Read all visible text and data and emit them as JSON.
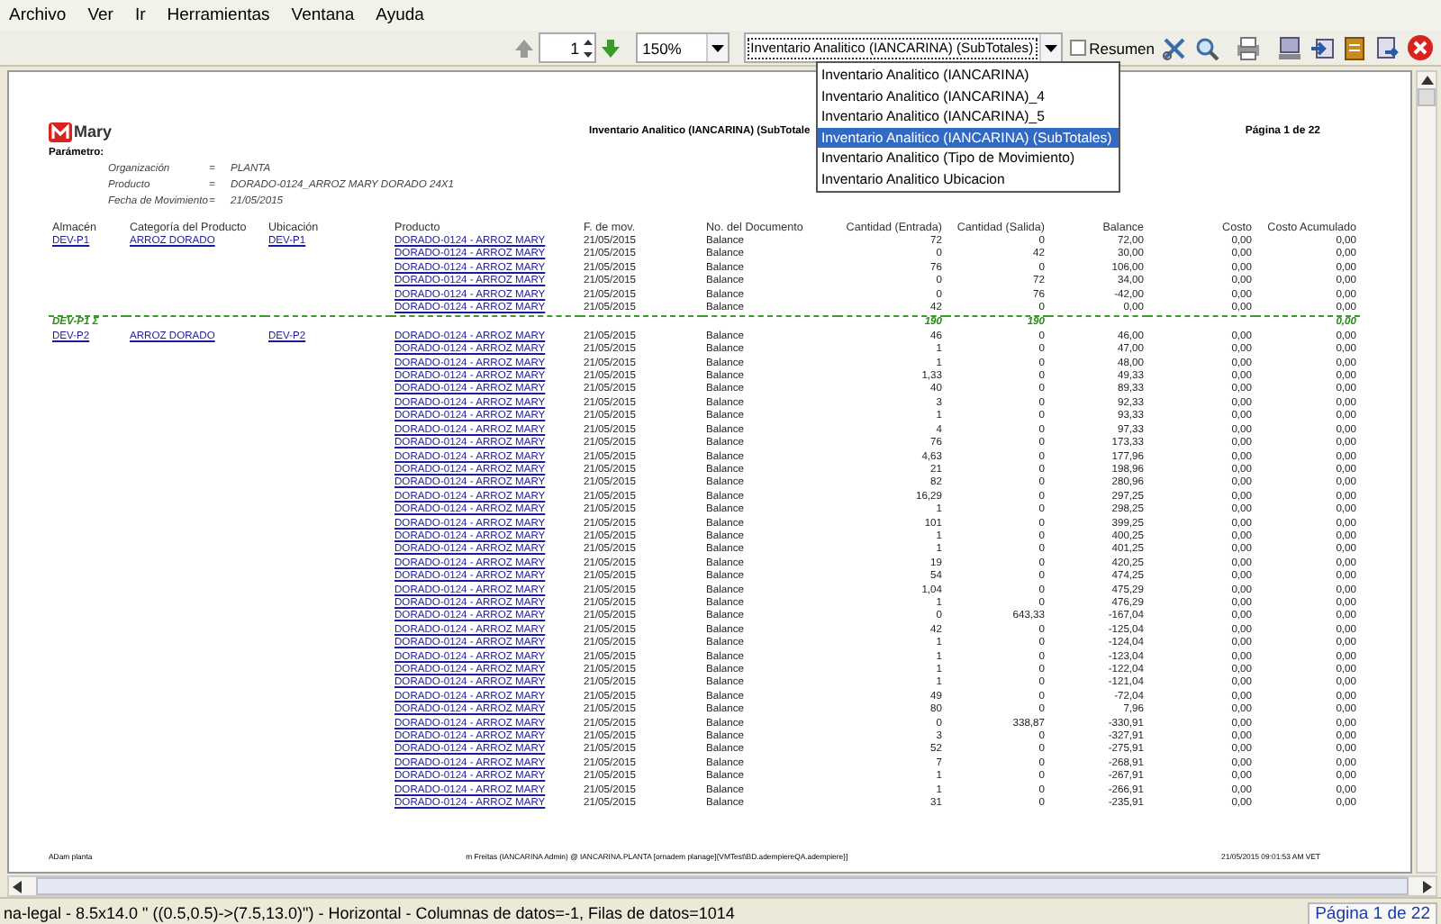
{
  "menu": [
    "Archivo",
    "Ver",
    "Ir",
    "Herramientas",
    "Ventana",
    "Ayuda"
  ],
  "toolbar": {
    "page": "1",
    "zoom": "150%",
    "report": "Inventario Analitico (IANCARINA) (SubTotales)",
    "summary": {
      "label": "Resumen",
      "checked": false
    }
  },
  "report_menu": [
    {
      "label": "Inventario Analitico (IANCARINA)",
      "selected": false
    },
    {
      "label": "Inventario Analitico (IANCARINA)_4",
      "selected": false
    },
    {
      "label": "Inventario Analitico (IANCARINA)_5",
      "selected": false
    },
    {
      "label": "Inventario Analitico (IANCARINA) (SubTotales)",
      "selected": true
    },
    {
      "label": "Inventario Analitico (Tipo de Movimiento)",
      "selected": false
    },
    {
      "label": "Inventario Analitico Ubicacion",
      "selected": false
    }
  ],
  "report": {
    "logo": "Mary",
    "title": "Inventario Analitico (IANCARINA) (SubTotale",
    "page": "Página 1 de 22",
    "parameters_label": "Parámetro:",
    "parameters": [
      {
        "name": "Organización",
        "sign": "=",
        "value": "PLANTA"
      },
      {
        "name": "Producto",
        "sign": "=",
        "value": "DORADO-0124_ARROZ MARY DORADO 24X1"
      },
      {
        "name": "Fecha de Movimiento",
        "sign": "=",
        "value": "21/05/2015"
      }
    ],
    "columns": [
      "Almacén",
      "Categoría del Producto",
      "Ubicación",
      "Producto",
      "F. de mov.",
      "No. del Documento",
      "Cantidad (Entrada)",
      "Cantidad (Salida)",
      "Balance",
      "Costo",
      "Costo Acumulado"
    ],
    "groups": [
      {
        "warehouse": "DEV-P1",
        "category": "ARROZ DORADO",
        "location": "DEV-P1",
        "rows": [
          {
            "product": "DORADO-0124 - ARROZ MARY",
            "date": "21/05/2015",
            "document": "Balance",
            "qty_in": "72",
            "qty_out": "0",
            "balance": "72,00",
            "cost": "0,00",
            "cumulative_cost": "0,00"
          },
          {
            "product": "DORADO-0124 - ARROZ MARY",
            "date": "21/05/2015",
            "document": "Balance",
            "qty_in": "0",
            "qty_out": "42",
            "balance": "30,00",
            "cost": "0,00",
            "cumulative_cost": "0,00"
          },
          {
            "product": "DORADO-0124 - ARROZ MARY",
            "date": "21/05/2015",
            "document": "Balance",
            "qty_in": "76",
            "qty_out": "0",
            "balance": "106,00",
            "cost": "0,00",
            "cumulative_cost": "0,00"
          },
          {
            "product": "DORADO-0124 - ARROZ MARY",
            "date": "21/05/2015",
            "document": "Balance",
            "qty_in": "0",
            "qty_out": "72",
            "balance": "34,00",
            "cost": "0,00",
            "cumulative_cost": "0,00"
          },
          {
            "product": "DORADO-0124 - ARROZ MARY",
            "date": "21/05/2015",
            "document": "Balance",
            "qty_in": "0",
            "qty_out": "76",
            "balance": "-42,00",
            "cost": "0,00",
            "cumulative_cost": "0,00"
          },
          {
            "product": "DORADO-0124 - ARROZ MARY",
            "date": "21/05/2015",
            "document": "Balance",
            "qty_in": "42",
            "qty_out": "0",
            "balance": "0,00",
            "cost": "0,00",
            "cumulative_cost": "0,00"
          }
        ],
        "subtotal": {
          "label": "DEV-P1 Σ",
          "qty_in": "190",
          "qty_out": "190",
          "cumulative_cost": "0,00"
        }
      },
      {
        "warehouse": "DEV-P2",
        "category": "ARROZ DORADO",
        "location": "DEV-P2",
        "rows": [
          {
            "product": "DORADO-0124 - ARROZ MARY",
            "date": "21/05/2015",
            "document": "Balance",
            "qty_in": "46",
            "qty_out": "0",
            "balance": "46,00",
            "cost": "0,00",
            "cumulative_cost": "0,00"
          },
          {
            "product": "DORADO-0124 - ARROZ MARY",
            "date": "21/05/2015",
            "document": "Balance",
            "qty_in": "1",
            "qty_out": "0",
            "balance": "47,00",
            "cost": "0,00",
            "cumulative_cost": "0,00"
          },
          {
            "product": "DORADO-0124 - ARROZ MARY",
            "date": "21/05/2015",
            "document": "Balance",
            "qty_in": "1",
            "qty_out": "0",
            "balance": "48,00",
            "cost": "0,00",
            "cumulative_cost": "0,00"
          },
          {
            "product": "DORADO-0124 - ARROZ MARY",
            "date": "21/05/2015",
            "document": "Balance",
            "qty_in": "1,33",
            "qty_out": "0",
            "balance": "49,33",
            "cost": "0,00",
            "cumulative_cost": "0,00"
          },
          {
            "product": "DORADO-0124 - ARROZ MARY",
            "date": "21/05/2015",
            "document": "Balance",
            "qty_in": "40",
            "qty_out": "0",
            "balance": "89,33",
            "cost": "0,00",
            "cumulative_cost": "0,00"
          },
          {
            "product": "DORADO-0124 - ARROZ MARY",
            "date": "21/05/2015",
            "document": "Balance",
            "qty_in": "3",
            "qty_out": "0",
            "balance": "92,33",
            "cost": "0,00",
            "cumulative_cost": "0,00"
          },
          {
            "product": "DORADO-0124 - ARROZ MARY",
            "date": "21/05/2015",
            "document": "Balance",
            "qty_in": "1",
            "qty_out": "0",
            "balance": "93,33",
            "cost": "0,00",
            "cumulative_cost": "0,00"
          },
          {
            "product": "DORADO-0124 - ARROZ MARY",
            "date": "21/05/2015",
            "document": "Balance",
            "qty_in": "4",
            "qty_out": "0",
            "balance": "97,33",
            "cost": "0,00",
            "cumulative_cost": "0,00"
          },
          {
            "product": "DORADO-0124 - ARROZ MARY",
            "date": "21/05/2015",
            "document": "Balance",
            "qty_in": "76",
            "qty_out": "0",
            "balance": "173,33",
            "cost": "0,00",
            "cumulative_cost": "0,00"
          },
          {
            "product": "DORADO-0124 - ARROZ MARY",
            "date": "21/05/2015",
            "document": "Balance",
            "qty_in": "4,63",
            "qty_out": "0",
            "balance": "177,96",
            "cost": "0,00",
            "cumulative_cost": "0,00"
          },
          {
            "product": "DORADO-0124 - ARROZ MARY",
            "date": "21/05/2015",
            "document": "Balance",
            "qty_in": "21",
            "qty_out": "0",
            "balance": "198,96",
            "cost": "0,00",
            "cumulative_cost": "0,00"
          },
          {
            "product": "DORADO-0124 - ARROZ MARY",
            "date": "21/05/2015",
            "document": "Balance",
            "qty_in": "82",
            "qty_out": "0",
            "balance": "280,96",
            "cost": "0,00",
            "cumulative_cost": "0,00"
          },
          {
            "product": "DORADO-0124 - ARROZ MARY",
            "date": "21/05/2015",
            "document": "Balance",
            "qty_in": "16,29",
            "qty_out": "0",
            "balance": "297,25",
            "cost": "0,00",
            "cumulative_cost": "0,00"
          },
          {
            "product": "DORADO-0124 - ARROZ MARY",
            "date": "21/05/2015",
            "document": "Balance",
            "qty_in": "1",
            "qty_out": "0",
            "balance": "298,25",
            "cost": "0,00",
            "cumulative_cost": "0,00"
          },
          {
            "product": "DORADO-0124 - ARROZ MARY",
            "date": "21/05/2015",
            "document": "Balance",
            "qty_in": "101",
            "qty_out": "0",
            "balance": "399,25",
            "cost": "0,00",
            "cumulative_cost": "0,00"
          },
          {
            "product": "DORADO-0124 - ARROZ MARY",
            "date": "21/05/2015",
            "document": "Balance",
            "qty_in": "1",
            "qty_out": "0",
            "balance": "400,25",
            "cost": "0,00",
            "cumulative_cost": "0,00"
          },
          {
            "product": "DORADO-0124 - ARROZ MARY",
            "date": "21/05/2015",
            "document": "Balance",
            "qty_in": "1",
            "qty_out": "0",
            "balance": "401,25",
            "cost": "0,00",
            "cumulative_cost": "0,00"
          },
          {
            "product": "DORADO-0124 - ARROZ MARY",
            "date": "21/05/2015",
            "document": "Balance",
            "qty_in": "19",
            "qty_out": "0",
            "balance": "420,25",
            "cost": "0,00",
            "cumulative_cost": "0,00"
          },
          {
            "product": "DORADO-0124 - ARROZ MARY",
            "date": "21/05/2015",
            "document": "Balance",
            "qty_in": "54",
            "qty_out": "0",
            "balance": "474,25",
            "cost": "0,00",
            "cumulative_cost": "0,00"
          },
          {
            "product": "DORADO-0124 - ARROZ MARY",
            "date": "21/05/2015",
            "document": "Balance",
            "qty_in": "1,04",
            "qty_out": "0",
            "balance": "475,29",
            "cost": "0,00",
            "cumulative_cost": "0,00"
          },
          {
            "product": "DORADO-0124 - ARROZ MARY",
            "date": "21/05/2015",
            "document": "Balance",
            "qty_in": "1",
            "qty_out": "0",
            "balance": "476,29",
            "cost": "0,00",
            "cumulative_cost": "0,00"
          },
          {
            "product": "DORADO-0124 - ARROZ MARY",
            "date": "21/05/2015",
            "document": "Balance",
            "qty_in": "0",
            "qty_out": "643,33",
            "balance": "-167,04",
            "cost": "0,00",
            "cumulative_cost": "0,00"
          },
          {
            "product": "DORADO-0124 - ARROZ MARY",
            "date": "21/05/2015",
            "document": "Balance",
            "qty_in": "42",
            "qty_out": "0",
            "balance": "-125,04",
            "cost": "0,00",
            "cumulative_cost": "0,00"
          },
          {
            "product": "DORADO-0124 - ARROZ MARY",
            "date": "21/05/2015",
            "document": "Balance",
            "qty_in": "1",
            "qty_out": "0",
            "balance": "-124,04",
            "cost": "0,00",
            "cumulative_cost": "0,00"
          },
          {
            "product": "DORADO-0124 - ARROZ MARY",
            "date": "21/05/2015",
            "document": "Balance",
            "qty_in": "1",
            "qty_out": "0",
            "balance": "-123,04",
            "cost": "0,00",
            "cumulative_cost": "0,00"
          },
          {
            "product": "DORADO-0124 - ARROZ MARY",
            "date": "21/05/2015",
            "document": "Balance",
            "qty_in": "1",
            "qty_out": "0",
            "balance": "-122,04",
            "cost": "0,00",
            "cumulative_cost": "0,00"
          },
          {
            "product": "DORADO-0124 - ARROZ MARY",
            "date": "21/05/2015",
            "document": "Balance",
            "qty_in": "1",
            "qty_out": "0",
            "balance": "-121,04",
            "cost": "0,00",
            "cumulative_cost": "0,00"
          },
          {
            "product": "DORADO-0124 - ARROZ MARY",
            "date": "21/05/2015",
            "document": "Balance",
            "qty_in": "49",
            "qty_out": "0",
            "balance": "-72,04",
            "cost": "0,00",
            "cumulative_cost": "0,00"
          },
          {
            "product": "DORADO-0124 - ARROZ MARY",
            "date": "21/05/2015",
            "document": "Balance",
            "qty_in": "80",
            "qty_out": "0",
            "balance": "7,96",
            "cost": "0,00",
            "cumulative_cost": "0,00"
          },
          {
            "product": "DORADO-0124 - ARROZ MARY",
            "date": "21/05/2015",
            "document": "Balance",
            "qty_in": "0",
            "qty_out": "338,87",
            "balance": "-330,91",
            "cost": "0,00",
            "cumulative_cost": "0,00"
          },
          {
            "product": "DORADO-0124 - ARROZ MARY",
            "date": "21/05/2015",
            "document": "Balance",
            "qty_in": "3",
            "qty_out": "0",
            "balance": "-327,91",
            "cost": "0,00",
            "cumulative_cost": "0,00"
          },
          {
            "product": "DORADO-0124 - ARROZ MARY",
            "date": "21/05/2015",
            "document": "Balance",
            "qty_in": "52",
            "qty_out": "0",
            "balance": "-275,91",
            "cost": "0,00",
            "cumulative_cost": "0,00"
          },
          {
            "product": "DORADO-0124 - ARROZ MARY",
            "date": "21/05/2015",
            "document": "Balance",
            "qty_in": "7",
            "qty_out": "0",
            "balance": "-268,91",
            "cost": "0,00",
            "cumulative_cost": "0,00"
          },
          {
            "product": "DORADO-0124 - ARROZ MARY",
            "date": "21/05/2015",
            "document": "Balance",
            "qty_in": "1",
            "qty_out": "0",
            "balance": "-267,91",
            "cost": "0,00",
            "cumulative_cost": "0,00"
          },
          {
            "product": "DORADO-0124 - ARROZ MARY",
            "date": "21/05/2015",
            "document": "Balance",
            "qty_in": "1",
            "qty_out": "0",
            "balance": "-266,91",
            "cost": "0,00",
            "cumulative_cost": "0,00"
          },
          {
            "product": "DORADO-0124 - ARROZ MARY",
            "date": "21/05/2015",
            "document": "Balance",
            "qty_in": "31",
            "qty_out": "0",
            "balance": "-235,91",
            "cost": "0,00",
            "cumulative_cost": "0,00"
          }
        ]
      }
    ],
    "footer": {
      "left": "ADam planta",
      "center": "m Freitas (IANCARINA Admin) @ IANCARINA.PLANTA [ornadem planage]{VMTest\\BD.adempiereQA.adempiere}]",
      "right": "21/05/2015 09:01:53 AM VET"
    }
  },
  "status_bar": {
    "text": "na-legal - 8.5x14.0 \" ((0.5,0.5)->(7.5,13.0)\") - Horizontal - Columnas de datos=-1, Filas de datos=1014",
    "page": "Página 1 de 22"
  }
}
